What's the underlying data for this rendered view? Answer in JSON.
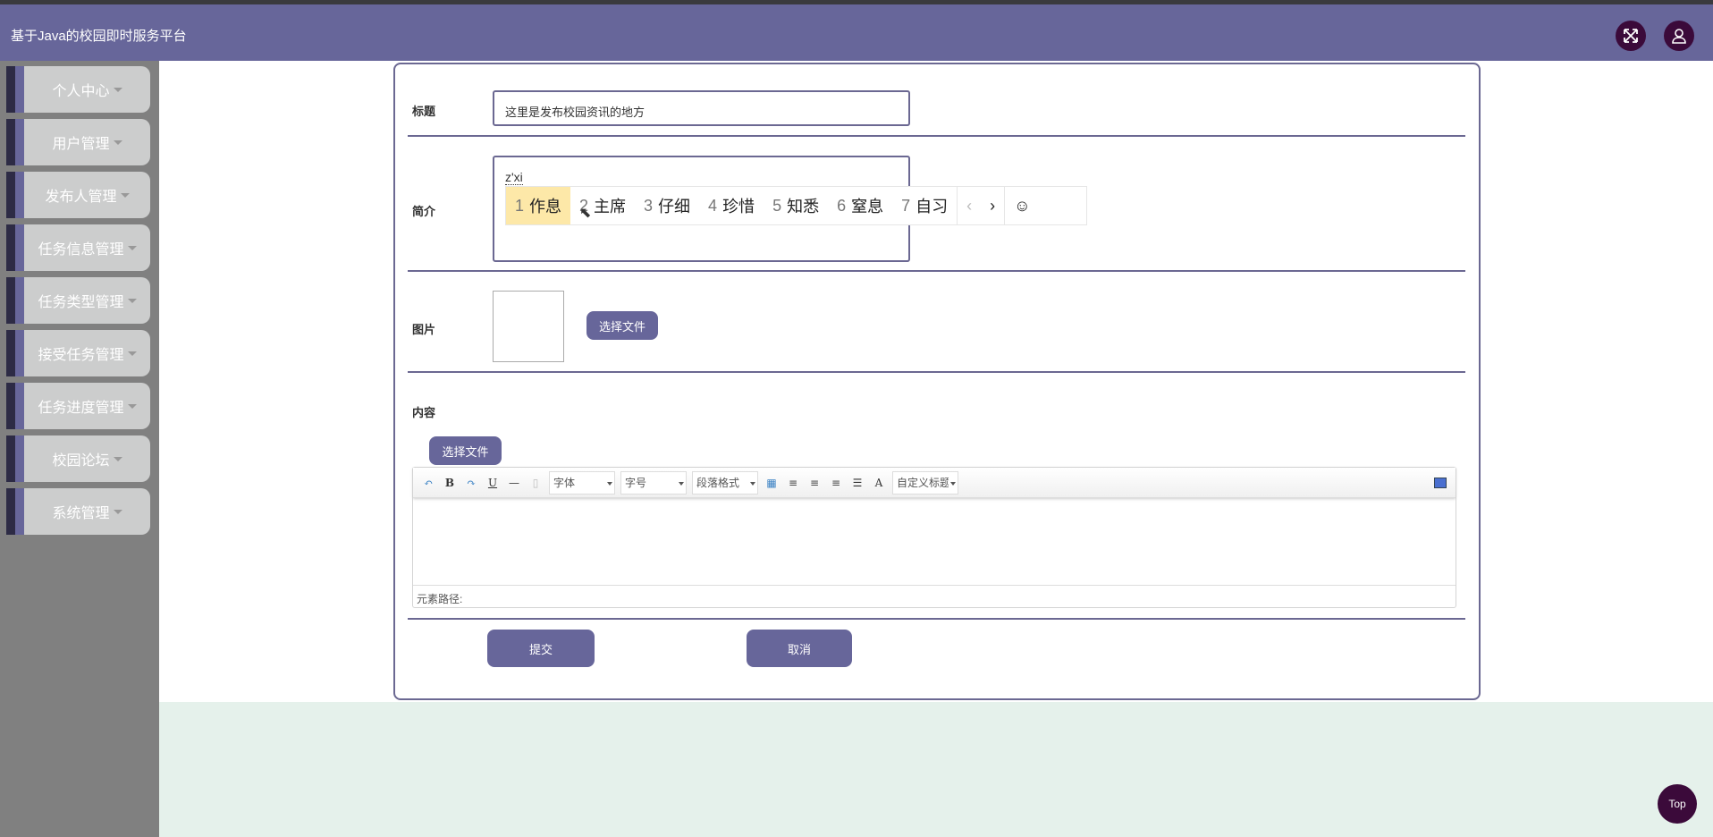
{
  "header": {
    "title": "基于Java的校园即时服务平台",
    "icons": [
      "fullscreen-icon",
      "user-icon"
    ]
  },
  "sidebar": {
    "items": [
      {
        "label": "个人中心"
      },
      {
        "label": "用户管理"
      },
      {
        "label": "发布人管理"
      },
      {
        "label": "任务信息管理"
      },
      {
        "label": "任务类型管理"
      },
      {
        "label": "接受任务管理"
      },
      {
        "label": "任务进度管理"
      },
      {
        "label": "校园论坛"
      },
      {
        "label": "系统管理"
      }
    ]
  },
  "form": {
    "title_label": "标题",
    "title_value": "这里是发布校园资讯的地方",
    "intro_label": "简介",
    "intro_value": "z'xi",
    "image_label": "图片",
    "image_button": "选择文件",
    "content_label": "内容",
    "content_button": "选择文件",
    "submit": "提交",
    "cancel": "取消"
  },
  "ime": {
    "candidates": [
      {
        "n": "1",
        "t": "作息"
      },
      {
        "n": "2",
        "t": "主席"
      },
      {
        "n": "3",
        "t": "仔细"
      },
      {
        "n": "4",
        "t": "珍惜"
      },
      {
        "n": "5",
        "t": "知悉"
      },
      {
        "n": "6",
        "t": "窒息"
      },
      {
        "n": "7",
        "t": "自习"
      }
    ],
    "prev": "‹",
    "next": "›",
    "emoji": "☺"
  },
  "editor": {
    "font": "字体",
    "size": "字号",
    "paragraph": "段落格式",
    "custom_title": "自定义标题",
    "bold": "B",
    "underline": "U",
    "color_a": "A",
    "status": "元素路径:"
  },
  "top_button": "Top"
}
